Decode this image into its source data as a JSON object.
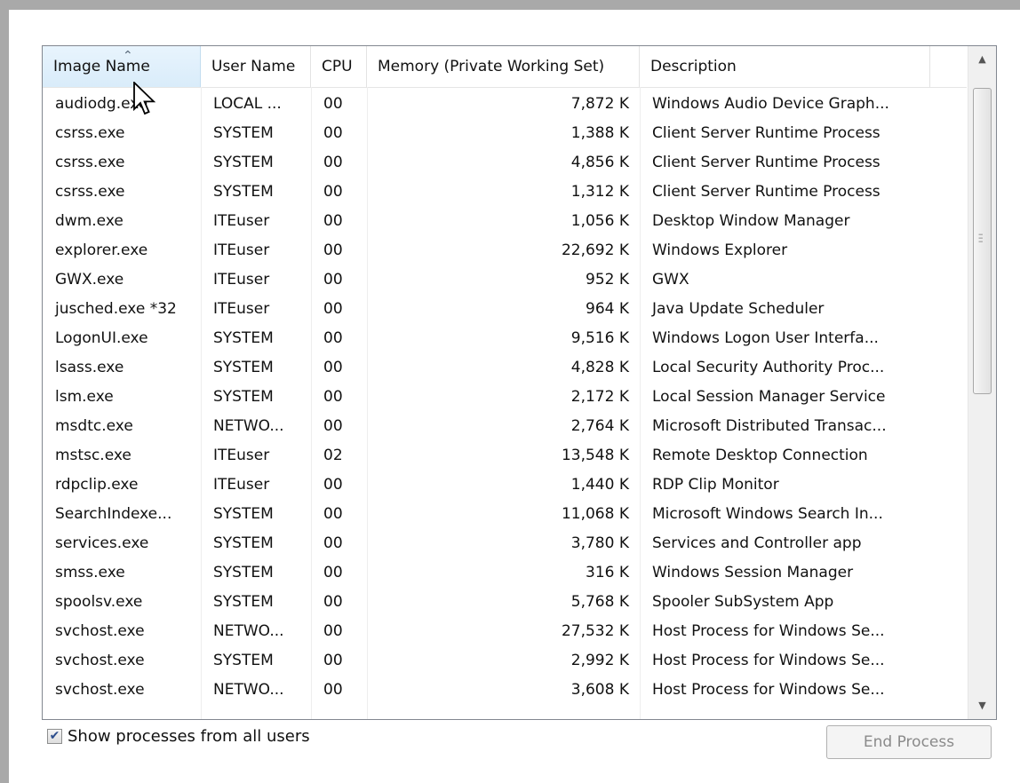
{
  "columns": {
    "image_name": "Image Name",
    "user_name": "User Name",
    "cpu": "CPU",
    "memory": "Memory (Private Working Set)",
    "description": "Description"
  },
  "processes": [
    {
      "image": "audiodg.exe",
      "user": "LOCAL ...",
      "cpu": "00",
      "memory": "7,872 K",
      "description": "Windows Audio Device Graph..."
    },
    {
      "image": "csrss.exe",
      "user": "SYSTEM",
      "cpu": "00",
      "memory": "1,388 K",
      "description": "Client Server Runtime Process"
    },
    {
      "image": "csrss.exe",
      "user": "SYSTEM",
      "cpu": "00",
      "memory": "4,856 K",
      "description": "Client Server Runtime Process"
    },
    {
      "image": "csrss.exe",
      "user": "SYSTEM",
      "cpu": "00",
      "memory": "1,312 K",
      "description": "Client Server Runtime Process"
    },
    {
      "image": "dwm.exe",
      "user": "ITEuser",
      "cpu": "00",
      "memory": "1,056 K",
      "description": "Desktop Window Manager"
    },
    {
      "image": "explorer.exe",
      "user": "ITEuser",
      "cpu": "00",
      "memory": "22,692 K",
      "description": "Windows Explorer"
    },
    {
      "image": "GWX.exe",
      "user": "ITEuser",
      "cpu": "00",
      "memory": "952 K",
      "description": "GWX"
    },
    {
      "image": "jusched.exe *32",
      "user": "ITEuser",
      "cpu": "00",
      "memory": "964 K",
      "description": "Java Update Scheduler"
    },
    {
      "image": "LogonUI.exe",
      "user": "SYSTEM",
      "cpu": "00",
      "memory": "9,516 K",
      "description": "Windows Logon User Interfa..."
    },
    {
      "image": "lsass.exe",
      "user": "SYSTEM",
      "cpu": "00",
      "memory": "4,828 K",
      "description": "Local Security Authority Proc..."
    },
    {
      "image": "lsm.exe",
      "user": "SYSTEM",
      "cpu": "00",
      "memory": "2,172 K",
      "description": "Local Session Manager Service"
    },
    {
      "image": "msdtc.exe",
      "user": "NETWO...",
      "cpu": "00",
      "memory": "2,764 K",
      "description": "Microsoft Distributed Transac..."
    },
    {
      "image": "mstsc.exe",
      "user": "ITEuser",
      "cpu": "02",
      "memory": "13,548 K",
      "description": "Remote Desktop Connection"
    },
    {
      "image": "rdpclip.exe",
      "user": "ITEuser",
      "cpu": "00",
      "memory": "1,440 K",
      "description": "RDP Clip Monitor"
    },
    {
      "image": "SearchIndexe...",
      "user": "SYSTEM",
      "cpu": "00",
      "memory": "11,068 K",
      "description": "Microsoft Windows Search In..."
    },
    {
      "image": "services.exe",
      "user": "SYSTEM",
      "cpu": "00",
      "memory": "3,780 K",
      "description": "Services and Controller app"
    },
    {
      "image": "smss.exe",
      "user": "SYSTEM",
      "cpu": "00",
      "memory": "316 K",
      "description": "Windows Session Manager"
    },
    {
      "image": "spoolsv.exe",
      "user": "SYSTEM",
      "cpu": "00",
      "memory": "5,768 K",
      "description": "Spooler SubSystem App"
    },
    {
      "image": "svchost.exe",
      "user": "NETWO...",
      "cpu": "00",
      "memory": "27,532 K",
      "description": "Host Process for Windows Se..."
    },
    {
      "image": "svchost.exe",
      "user": "SYSTEM",
      "cpu": "00",
      "memory": "2,992 K",
      "description": "Host Process for Windows Se..."
    },
    {
      "image": "svchost.exe",
      "user": "NETWO...",
      "cpu": "00",
      "memory": "3,608 K",
      "description": "Host Process for Windows Se..."
    }
  ],
  "show_all_users": {
    "label": "Show processes from all users",
    "checked": true
  },
  "end_process_label": "End Process",
  "icons": {
    "sort": "sort-ascending-icon",
    "cursor": "mouse-pointer-icon"
  },
  "colors": {
    "sorted_header": "#d9ecfa",
    "disabled_text": "#8a8a8a"
  }
}
